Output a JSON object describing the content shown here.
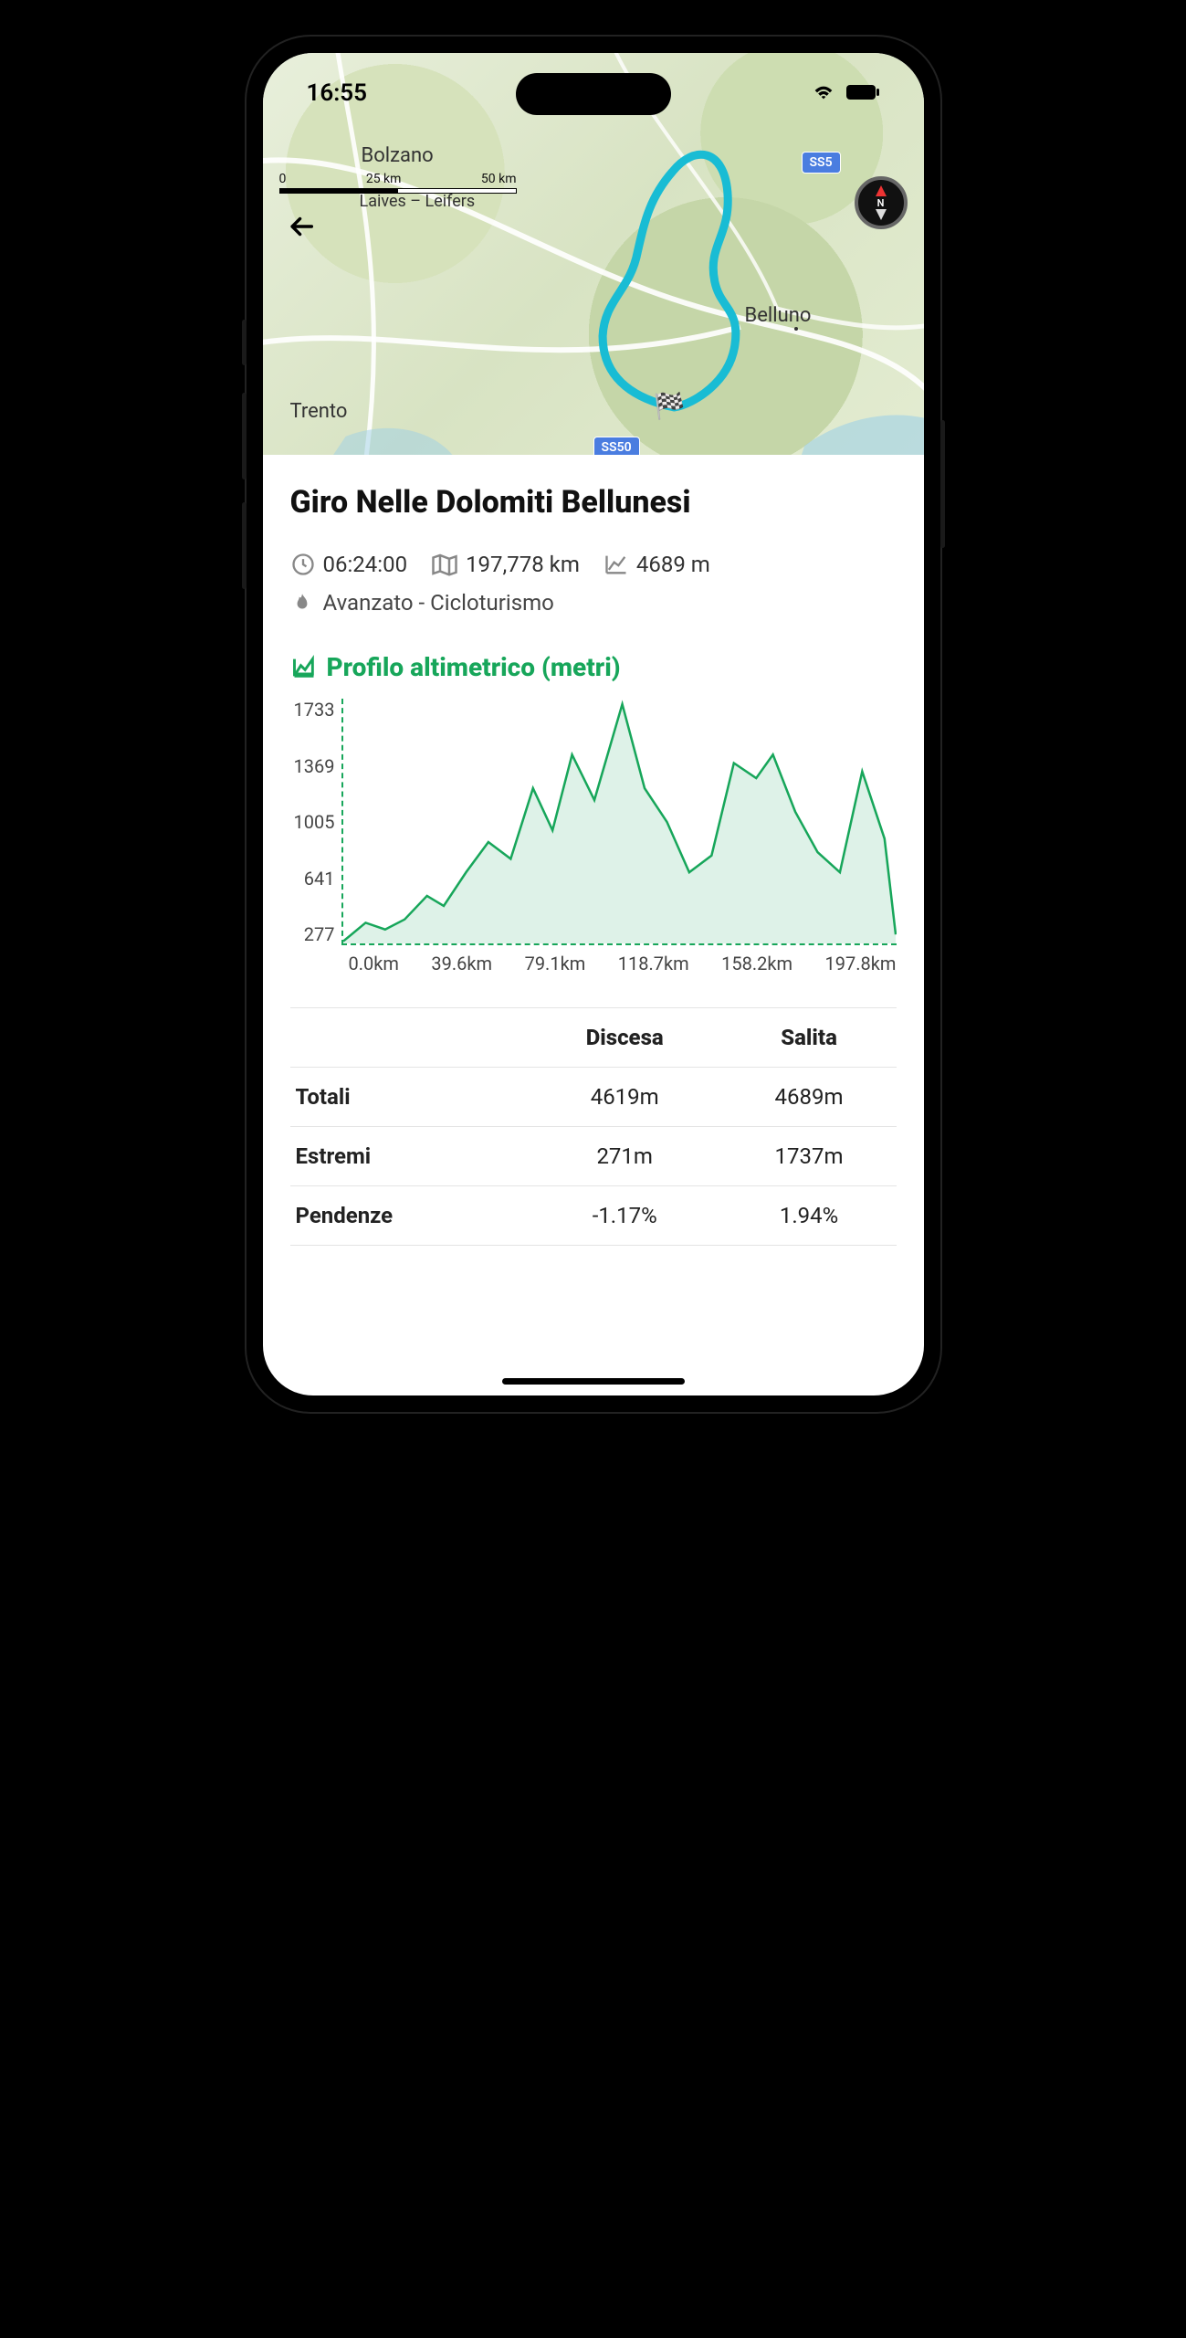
{
  "status": {
    "time": "16:55"
  },
  "map": {
    "cities": {
      "bolzano": "Bolzano",
      "laives": "Laives – Leifers",
      "trento": "Trento",
      "belluno": "Belluno"
    },
    "scale": {
      "t0": "0",
      "t1": "25 km",
      "t2": "50 km"
    },
    "roads": {
      "ss50": "SS50",
      "ss5": "SS5"
    },
    "compass_letter": "N"
  },
  "route": {
    "title": "Giro Nelle Dolomiti Bellunesi",
    "duration": "06:24:00",
    "distance": "197,778 km",
    "ascent": "4689 m",
    "level": "Avanzato - Cicloturismo"
  },
  "section": {
    "elevation_title": "Profilo altimetrico (metri)"
  },
  "chart_data": {
    "type": "area",
    "title": "Profilo altimetrico (metri)",
    "xlabel": "km",
    "ylabel": "m",
    "ylim": [
      277,
      1733
    ],
    "y_ticks": [
      "1733",
      "1369",
      "1005",
      "641",
      "277"
    ],
    "x_ticks": [
      "0.0km",
      "39.6km",
      "79.1km",
      "118.7km",
      "158.2km",
      "197.8km"
    ],
    "x": [
      0,
      8,
      15,
      22,
      30,
      36,
      44,
      52,
      60,
      68,
      75,
      82,
      90,
      100,
      108,
      116,
      124,
      132,
      140,
      148,
      154,
      162,
      170,
      178,
      186,
      194,
      198
    ],
    "values": [
      290,
      400,
      360,
      420,
      560,
      500,
      700,
      880,
      780,
      1200,
      950,
      1400,
      1130,
      1700,
      1200,
      1000,
      700,
      800,
      1350,
      1260,
      1400,
      1060,
      820,
      700,
      1300,
      900,
      330
    ]
  },
  "table": {
    "headers": {
      "c0": "",
      "c1": "Discesa",
      "c2": "Salita"
    },
    "rows": [
      {
        "label": "Totali",
        "descent": "4619m",
        "ascent": "4689m"
      },
      {
        "label": "Estremi",
        "descent": "271m",
        "ascent": "1737m"
      },
      {
        "label": "Pendenze",
        "descent": "-1.17%",
        "ascent": "1.94%"
      }
    ]
  }
}
